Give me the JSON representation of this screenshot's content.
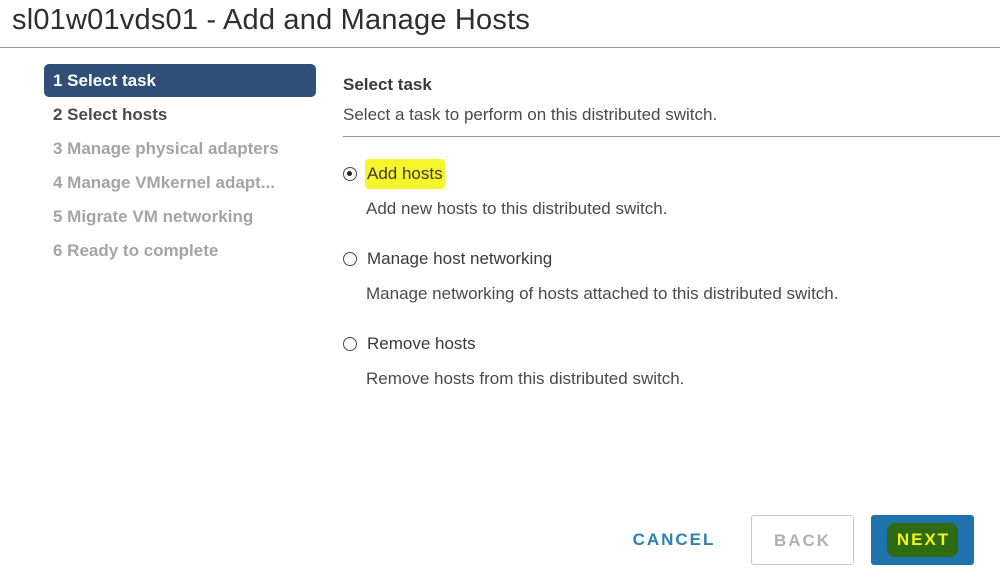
{
  "window": {
    "title": "sl01w01vds01 - Add and Manage Hosts"
  },
  "steps": [
    {
      "label": "1 Select task",
      "state": "active"
    },
    {
      "label": "2 Select hosts",
      "state": "enabled"
    },
    {
      "label": "3 Manage physical adapters",
      "state": "disabled"
    },
    {
      "label": "4 Manage VMkernel adapt...",
      "state": "disabled"
    },
    {
      "label": "5 Migrate VM networking",
      "state": "disabled"
    },
    {
      "label": "6 Ready to complete",
      "state": "disabled"
    }
  ],
  "content": {
    "heading": "Select task",
    "description": "Select a task to perform on this distributed switch.",
    "options": [
      {
        "label": "Add hosts",
        "description": "Add new hosts to this distributed switch.",
        "selected": true
      },
      {
        "label": "Manage host networking",
        "description": "Manage networking of hosts attached to this distributed switch.",
        "selected": false
      },
      {
        "label": "Remove hosts",
        "description": "Remove hosts from this distributed switch.",
        "selected": false
      }
    ]
  },
  "buttons": {
    "cancel": "CANCEL",
    "back": "BACK",
    "next": "NEXT"
  },
  "colors": {
    "active_step_bg": "#2f4f78",
    "primary_button": "#1e73ad",
    "link_text": "#2f7fb0",
    "highlight_yellow": "#f5f52a",
    "highlight_green": "#2f6b12"
  }
}
